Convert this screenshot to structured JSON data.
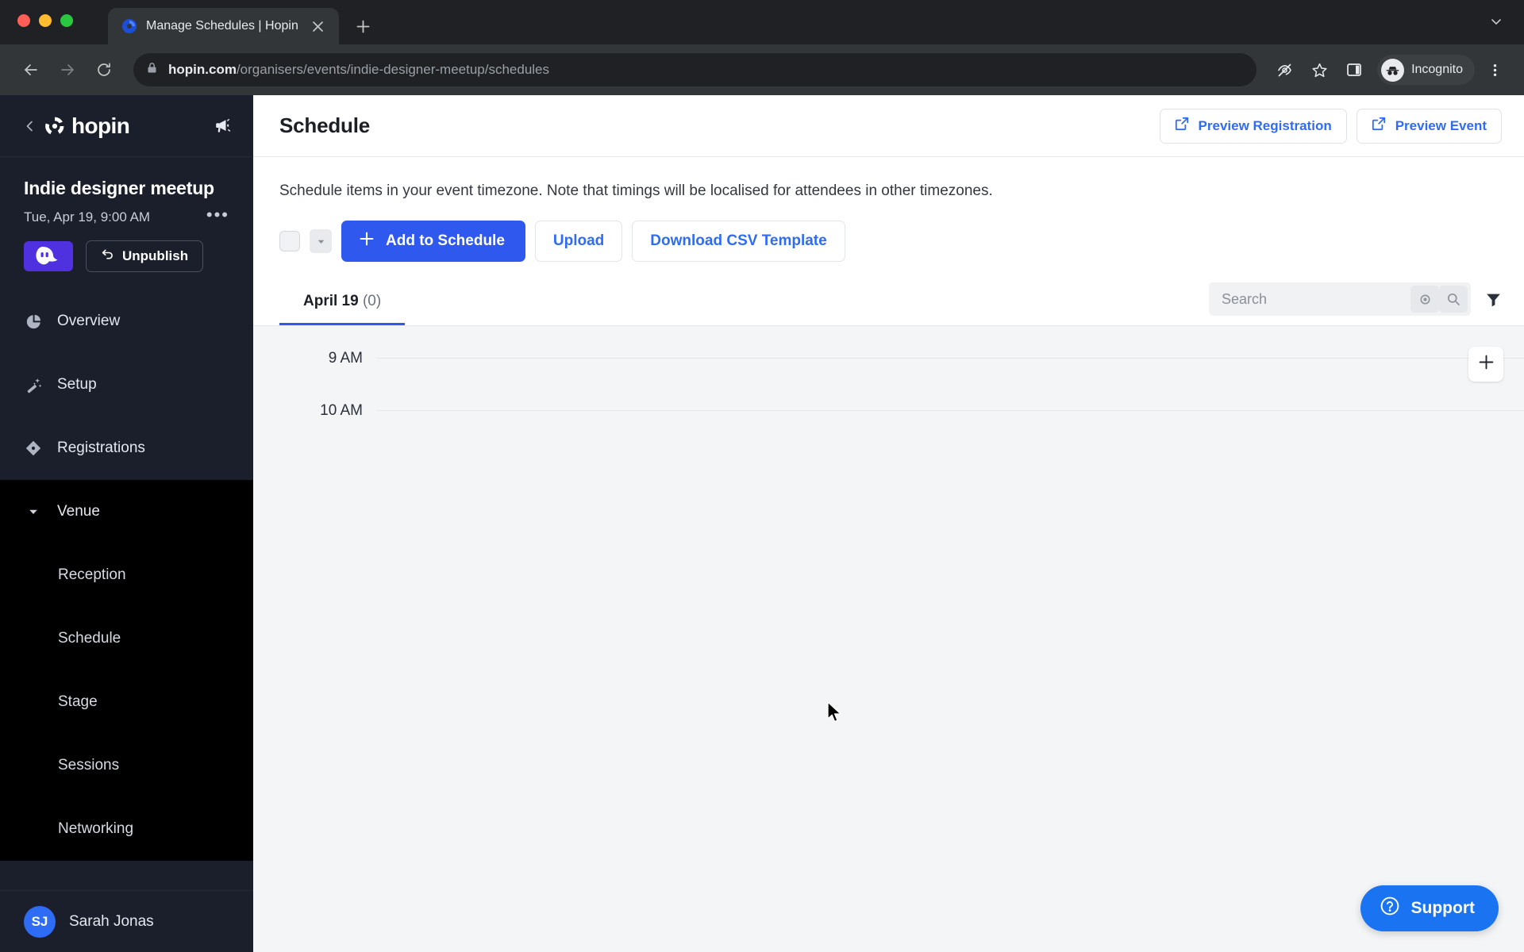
{
  "browser": {
    "tab": {
      "title": "Manage Schedules | Hopin",
      "favicon_icon": "hopin-favicon",
      "close_icon": "close-icon"
    },
    "new_tab_icon": "plus-icon",
    "tab_list_icon": "chevron-down-icon",
    "nav": {
      "back_icon": "arrow-left-icon",
      "forward_icon": "arrow-right-icon",
      "reload_icon": "reload-icon"
    },
    "omnibox": {
      "lock_icon": "lock-icon",
      "url_domain": "hopin.com",
      "url_path": "/organisers/events/indie-designer-meetup/schedules"
    },
    "toolbar_icons": [
      "eye-off-icon",
      "star-icon",
      "side-panel-icon",
      "more-vertical-icon"
    ],
    "profile": {
      "label": "Incognito",
      "icon": "incognito-icon"
    }
  },
  "sidebar": {
    "back_icon": "chevron-left-icon",
    "brand": "hopin",
    "brand_icon": "hopin-logo-icon",
    "announce_icon": "megaphone-icon",
    "event": {
      "name": "Indie designer meetup",
      "date": "Tue, Apr 19, 9:00 AM",
      "more_icon": "ellipsis-icon",
      "avatar_icon": "event-avatar-ghost",
      "unpublish_label": "Unpublish",
      "unpublish_icon": "undo-arrow-icon"
    },
    "items": [
      {
        "label": "Overview",
        "icon": "pie-chart-icon"
      },
      {
        "label": "Setup",
        "icon": "magic-wand-icon"
      },
      {
        "label": "Registrations",
        "icon": "ticket-icon"
      }
    ],
    "group": {
      "label": "Venue",
      "caret_icon": "caret-down-icon",
      "children": [
        "Reception",
        "Schedule",
        "Stage",
        "Sessions",
        "Networking"
      ]
    },
    "user": {
      "initials": "SJ",
      "name": "Sarah Jonas"
    }
  },
  "main": {
    "title": "Schedule",
    "header_actions": [
      {
        "label": "Preview Registration",
        "icon": "external-link-icon"
      },
      {
        "label": "Preview Event",
        "icon": "external-link-icon"
      }
    ],
    "blurb": "Schedule items in your event timezone. Note that timings will be localised for attendees in other timezones.",
    "actions": {
      "select_all_checkbox": "",
      "dropdown_icon": "caret-down-icon",
      "add_label": "Add to Schedule",
      "add_icon": "plus-icon",
      "upload_label": "Upload",
      "download_label": "Download CSV Template"
    },
    "tabs": [
      {
        "label": "April 19",
        "count": "(0)"
      }
    ],
    "search": {
      "placeholder": "Search",
      "value": "",
      "clear_icon": "clear-circle-icon",
      "search_icon": "search-icon"
    },
    "filter_icon": "funnel-icon",
    "timeline": {
      "rows": [
        {
          "time": "9 AM"
        },
        {
          "time": "10 AM"
        }
      ],
      "add_icon": "plus-icon"
    }
  },
  "support": {
    "label": "Support",
    "icon": "question-circle-icon"
  },
  "colors": {
    "accent": "#2f58ef",
    "link": "#2f6cf6",
    "sidebar_bg": "#1a1f2b",
    "group_bg": "#000000",
    "timeline_bg": "#f4f5f7"
  }
}
